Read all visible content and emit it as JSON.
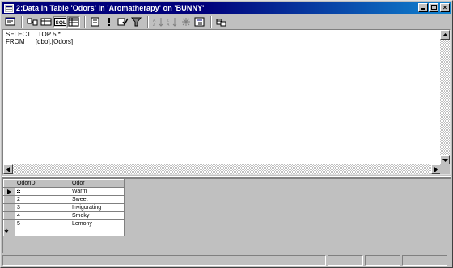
{
  "window": {
    "title": "2:Data in Table 'Odors' in 'Aromatherapy' on 'BUNNY'",
    "title_icon": "table-window-icon",
    "controls": {
      "minimize_icon": "minimize-icon",
      "maximize_icon": "maximize-icon",
      "close_glyph": "×"
    }
  },
  "toolbar": {
    "buttons": [
      {
        "name": "properties-icon"
      },
      {
        "name": "show-diagram-pane-icon"
      },
      {
        "name": "show-grid-pane-icon"
      },
      {
        "name": "show-sql-pane-icon",
        "label": "SQL"
      },
      {
        "name": "show-results-pane-icon"
      },
      {
        "name": "change-query-type-icon"
      },
      {
        "name": "run-icon",
        "label": "!"
      },
      {
        "name": "verify-sql-icon"
      },
      {
        "name": "remove-filter-icon"
      },
      {
        "name": "sort-ascending-icon"
      },
      {
        "name": "sort-descending-icon"
      },
      {
        "name": "auto-filter-icon"
      },
      {
        "name": "group-by-icon"
      },
      {
        "name": "add-table-icon"
      }
    ]
  },
  "sql_pane": {
    "text": "SELECT    TOP 5 *\nFROM      [dbo].[Odors]"
  },
  "results": {
    "columns": [
      "OdorID",
      "Odor"
    ],
    "rows": [
      {
        "id": "1",
        "odor": "Warm"
      },
      {
        "id": "2",
        "odor": "Sweet"
      },
      {
        "id": "3",
        "odor": "Invigorating"
      },
      {
        "id": "4",
        "odor": "Smoky"
      },
      {
        "id": "5",
        "odor": "Lemony"
      }
    ],
    "current_row_indicator": "▶",
    "new_row_indicator": "✱"
  },
  "colors": {
    "title_active": "#00007b",
    "title_gradient_end": "#1084d0",
    "face": "#c0c0c0"
  }
}
